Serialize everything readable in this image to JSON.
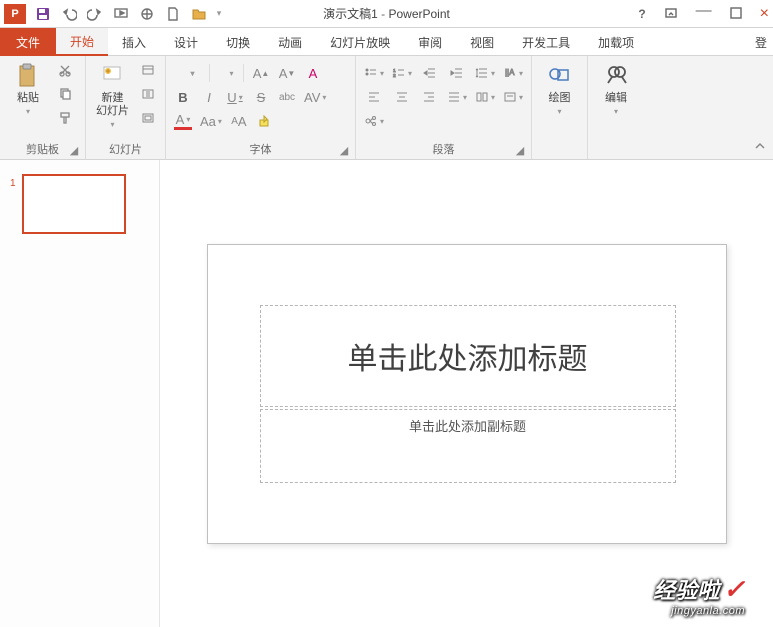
{
  "title": {
    "doc": "演示文稿1",
    "app": "PowerPoint"
  },
  "tabs": {
    "file": "文件",
    "home": "开始",
    "insert": "插入",
    "design": "设计",
    "transitions": "切换",
    "animations": "动画",
    "slideshow": "幻灯片放映",
    "review": "审阅",
    "view": "视图",
    "developer": "开发工具",
    "addins": "加载项",
    "login": "登"
  },
  "groups": {
    "clipboard": {
      "label": "剪贴板",
      "paste": "粘贴"
    },
    "slides": {
      "label": "幻灯片",
      "newslide": "新建\n幻灯片"
    },
    "font": {
      "label": "字体"
    },
    "paragraph": {
      "label": "段落"
    },
    "drawing": {
      "label": "绘图",
      "btn": "绘图"
    },
    "editing": {
      "label": "编辑",
      "btn": "编辑"
    }
  },
  "slide": {
    "title_placeholder": "单击此处添加标题",
    "subtitle_placeholder": "单击此处添加副标题",
    "thumb_number": "1"
  },
  "watermark": {
    "big": "经验啦",
    "small": "jingyanla.com"
  }
}
